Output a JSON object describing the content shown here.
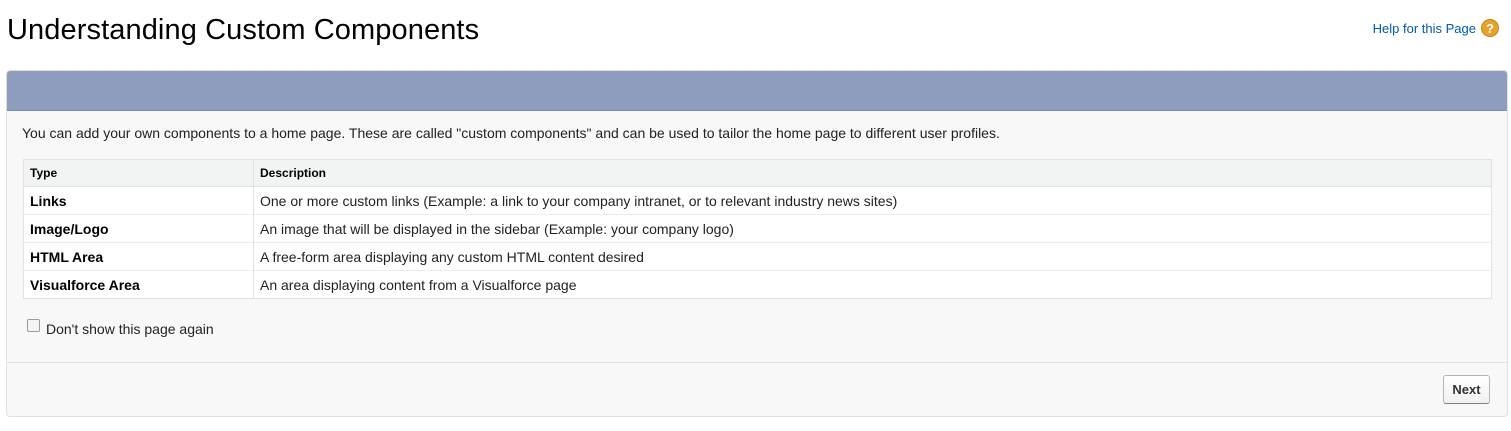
{
  "page": {
    "title": "Understanding Custom Components",
    "help_link": "Help for this Page",
    "help_icon_glyph": "?"
  },
  "intro_text": "You can add your own components to a home page. These are called \"custom components\" and can be used to tailor the home page to different user profiles.",
  "table": {
    "headers": [
      "Type",
      "Description"
    ],
    "rows": [
      {
        "type": "Links",
        "description": "One or more custom links (Example: a link to your company intranet, or to relevant industry news sites)"
      },
      {
        "type": "Image/Logo",
        "description": "An image that will be displayed in the sidebar (Example: your company logo)"
      },
      {
        "type": "HTML Area",
        "description": "A free-form area displaying any custom HTML content desired"
      },
      {
        "type": "Visualforce Area",
        "description": "An area displaying content from a Visualforce page"
      }
    ]
  },
  "dont_show": {
    "label": "Don't show this page again",
    "checked": false
  },
  "footer": {
    "next_label": "Next"
  },
  "colors": {
    "panel_header": "#8e9dbe",
    "help_link": "#015ba7",
    "help_icon": "#e8a12b"
  },
  "icons": {
    "help": "help-icon"
  }
}
